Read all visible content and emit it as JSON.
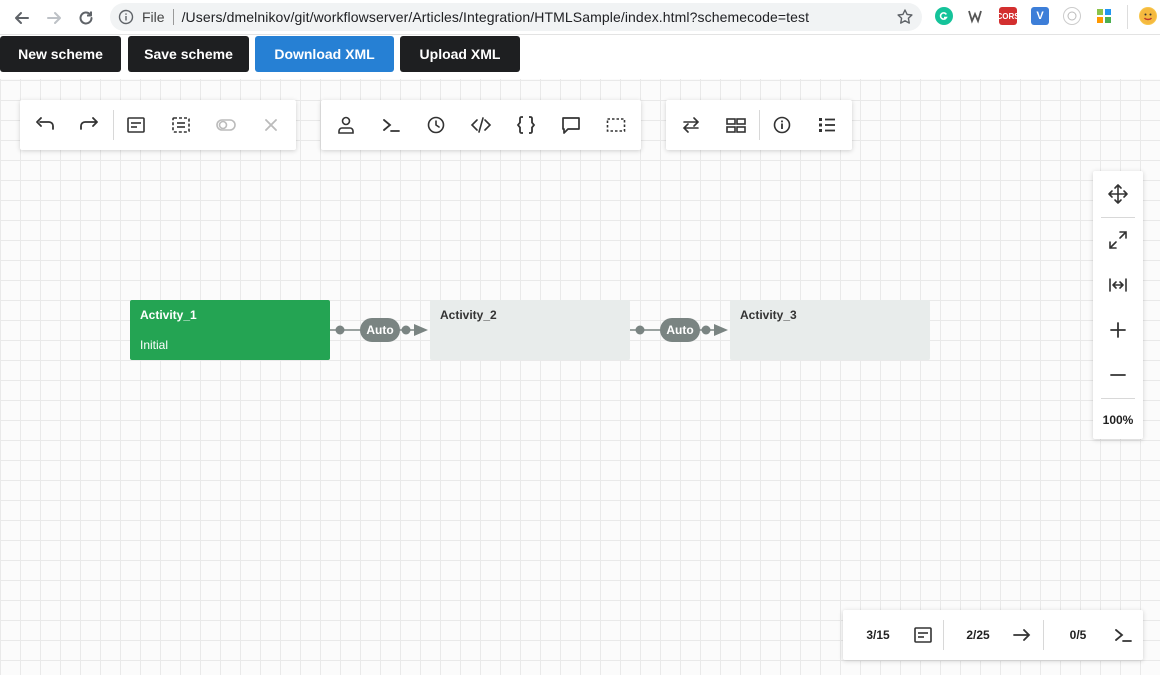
{
  "browser": {
    "file_label": "File",
    "url": "/Users/dmelnikov/git/workflowserver/Articles/Integration/HTMLSample/index.html?schemecode=test",
    "ext_cors_label": "CORS",
    "ext_v_label": "V"
  },
  "app_buttons": {
    "new_scheme": "New scheme",
    "save_scheme": "Save scheme",
    "download_xml": "Download XML",
    "upload_xml": "Upload XML"
  },
  "colors": {
    "dark_button": "#1e1f21",
    "primary_button": "#2680d4",
    "initial_activity": "#24a453",
    "activity": "#e8eceb",
    "transition": "#7a8482"
  },
  "activities": [
    {
      "name": "Activity_1",
      "subtitle": "Initial",
      "initial": true
    },
    {
      "name": "Activity_2",
      "subtitle": "",
      "initial": false
    },
    {
      "name": "Activity_3",
      "subtitle": "",
      "initial": false
    }
  ],
  "transitions": [
    {
      "label": "Auto",
      "from": "Activity_1",
      "to": "Activity_2"
    },
    {
      "label": "Auto",
      "from": "Activity_2",
      "to": "Activity_3"
    }
  ],
  "zoom": {
    "level": "100%"
  },
  "status": {
    "activities_count": "3/15",
    "transitions_count": "2/25",
    "commands_count": "0/5"
  },
  "icons": {
    "toolbar_left": [
      "undo-icon",
      "redo-icon",
      "activity-icon",
      "transition-icon",
      "toggle-icon",
      "delete-icon"
    ],
    "toolbar_middle": [
      "actors-icon",
      "commands-icon",
      "timers-icon",
      "code-actions-icon",
      "parameters-icon",
      "comments-icon",
      "selection-icon"
    ],
    "toolbar_right": [
      "sync-icon",
      "layout-icon",
      "info-icon",
      "list-icon"
    ],
    "zoom_panel": [
      "move-icon",
      "fullscreen-icon",
      "fit-width-icon",
      "zoom-in-icon",
      "zoom-out-icon"
    ]
  }
}
